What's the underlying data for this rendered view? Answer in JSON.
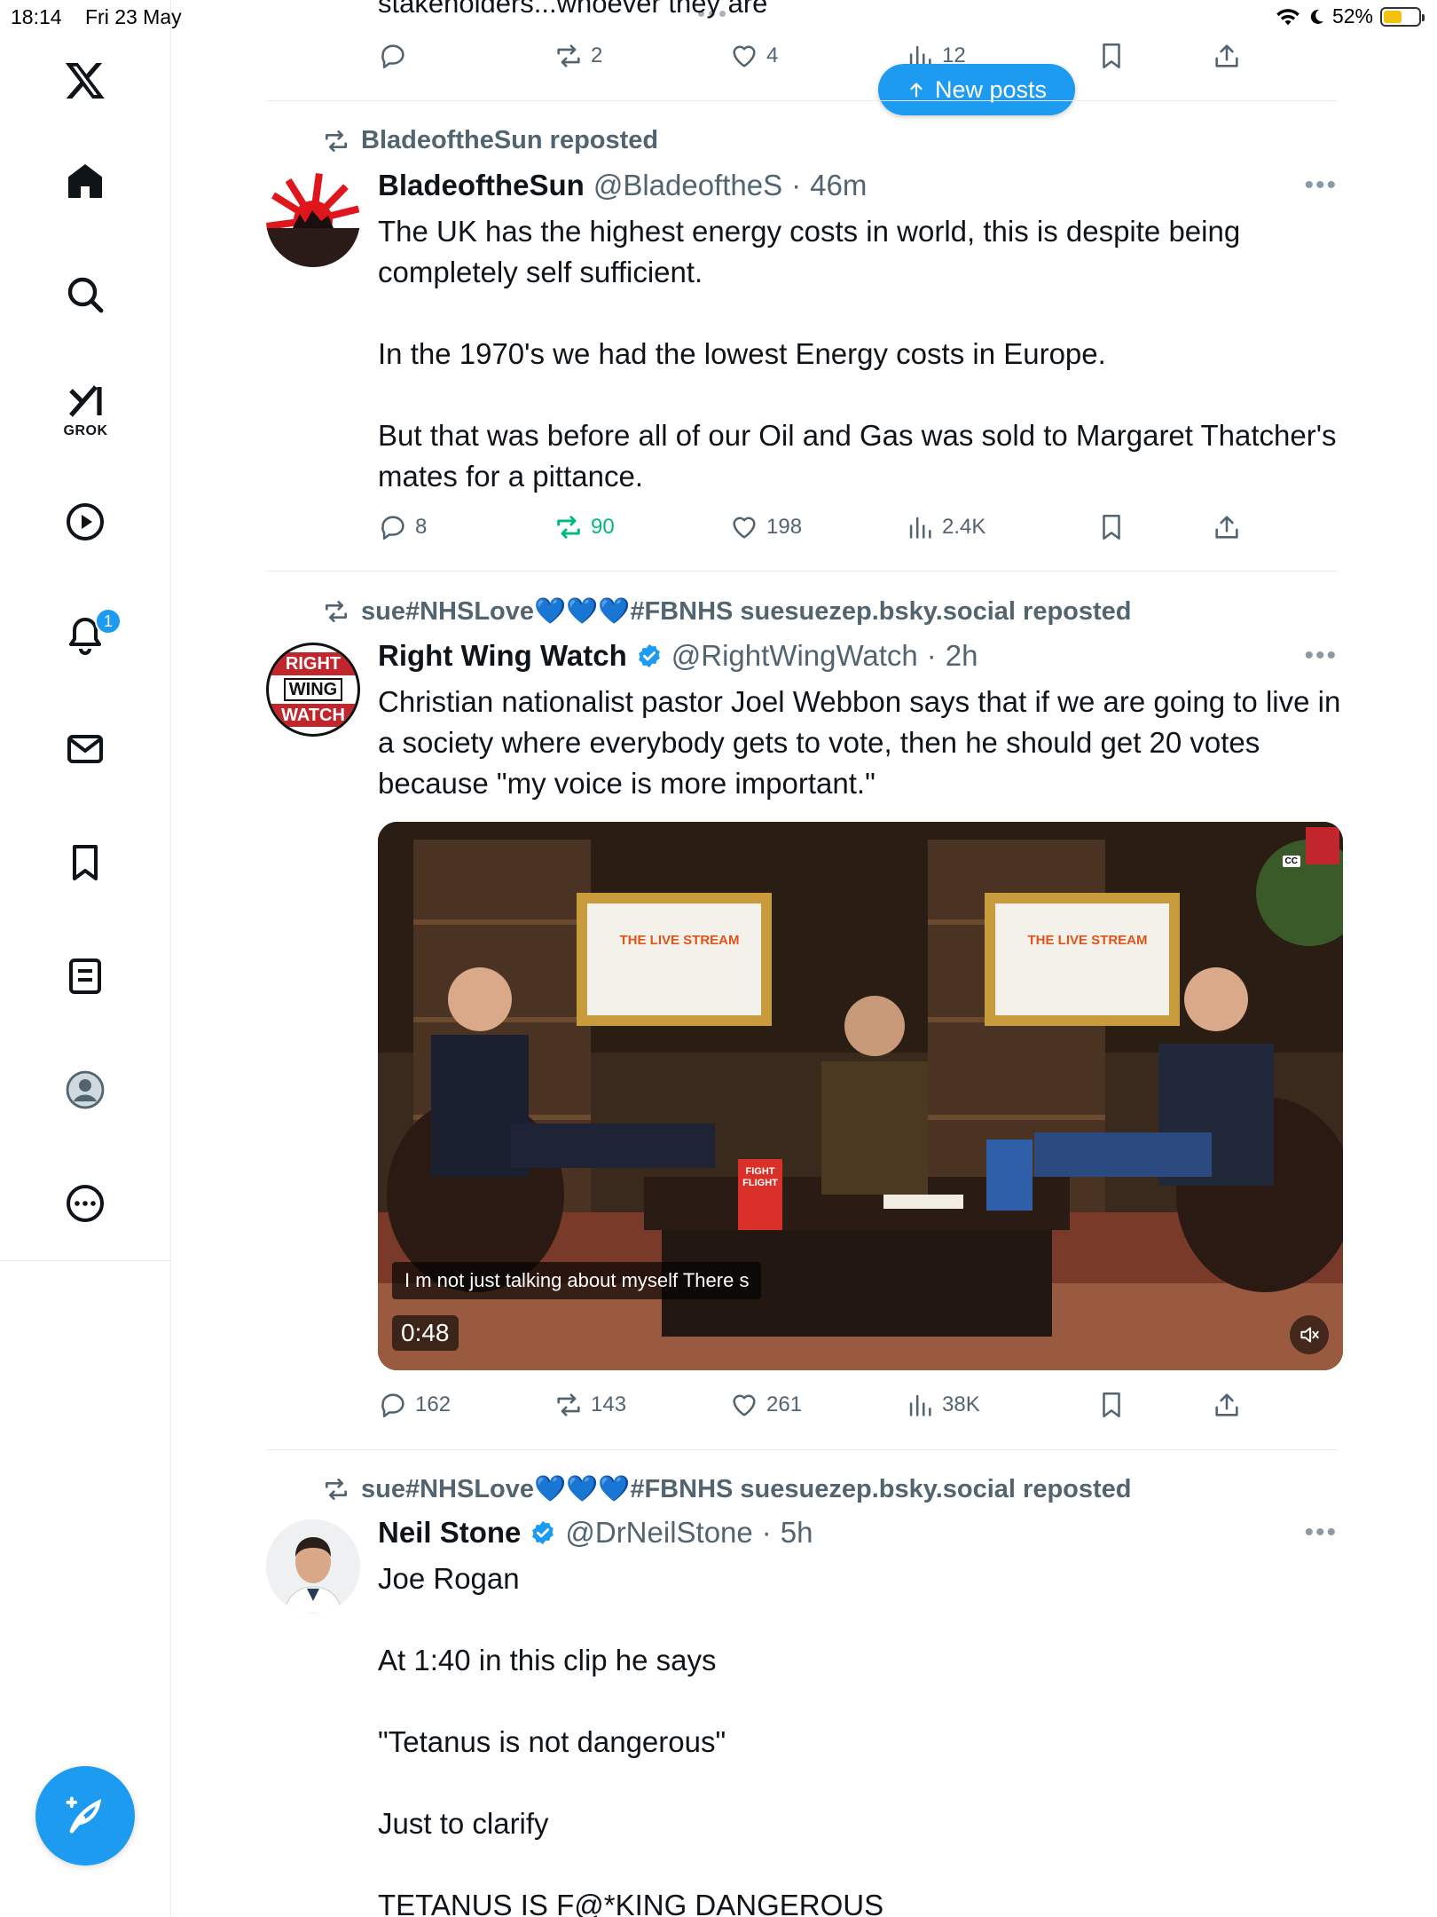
{
  "status_bar": {
    "time": "18:14",
    "date": "Fri 23 May",
    "battery": "52%",
    "battery_level": 0.52
  },
  "colors": {
    "accent": "#1d9bf0",
    "repost_active": "#00ba7c",
    "muted_text": "#536471"
  },
  "sidebar": {
    "items": [
      {
        "name": "x-logo",
        "icon": "x-logo-icon"
      },
      {
        "name": "home",
        "icon": "home-icon"
      },
      {
        "name": "explore",
        "icon": "search-icon"
      },
      {
        "name": "grok",
        "icon": "grok-icon",
        "label": "GROK"
      },
      {
        "name": "video",
        "icon": "play-icon"
      },
      {
        "name": "notifications",
        "icon": "bell-icon",
        "badge": "1"
      },
      {
        "name": "messages",
        "icon": "mail-icon"
      },
      {
        "name": "bookmarks",
        "icon": "bookmark-icon"
      },
      {
        "name": "lists",
        "icon": "list-icon"
      },
      {
        "name": "profile",
        "icon": "avatar-icon"
      },
      {
        "name": "more",
        "icon": "more-circle-icon"
      }
    ],
    "compose_icon": "compose-feather-icon"
  },
  "new_posts_pill": {
    "label": "New posts",
    "icon": "arrow-up-icon"
  },
  "tweets": [
    {
      "partial_text": "stakeholders...whoever they are",
      "stats": {
        "replies": "",
        "reposts": "2",
        "likes": "4",
        "views": "12"
      }
    },
    {
      "repost_by": "BladeoftheSun reposted",
      "name": "BladeoftheSun",
      "handle": "@BladeoftheS",
      "time": "46m",
      "verified": false,
      "text": "The UK has the highest energy costs in world, this is despite being completely self sufficient.\n\nIn the 1970's we had the lowest Energy costs in Europe.\n\nBut that was before all of our Oil and Gas was sold to Margaret Thatcher's mates for a pittance.",
      "stats": {
        "replies": "8",
        "reposts": "90",
        "likes": "198",
        "views": "2.4K"
      },
      "reposted_by_me": true
    },
    {
      "repost_by_prefix": "sue#NHSLove",
      "repost_by_hearts": "💙💙💙",
      "repost_by_suffix": "#FBNHS suesuezep.bsky.social reposted",
      "name": "Right Wing Watch",
      "handle": "@RightWingWatch",
      "time": "2h",
      "verified": true,
      "avatar_text": [
        "RIGHT",
        "WING",
        "WATCH"
      ],
      "text": "Christian nationalist pastor Joel Webbon says that if we are going to live in a society where everybody gets to vote, then he should get 20 votes because \"my voice is more important.\"",
      "video": {
        "caption": "I m not just talking about myself There s",
        "duration": "0:48",
        "screen_text_left": "THE LIVE STREAM",
        "screen_text_right": "THE LIVE STREAM",
        "book_text": "FIGHT FLIGHT",
        "cc_label": "CC"
      },
      "stats": {
        "replies": "162",
        "reposts": "143",
        "likes": "261",
        "views": "38K"
      }
    },
    {
      "repost_by_prefix": "sue#NHSLove",
      "repost_by_hearts": "💙💙💙",
      "repost_by_suffix": "#FBNHS suesuezep.bsky.social reposted",
      "name": "Neil Stone",
      "handle": "@DrNeilStone",
      "time": "5h",
      "verified": true,
      "text": "Joe Rogan\n\nAt 1:40 in this clip he says\n\n\"Tetanus is not dangerous\"\n\nJust to clarify\n\nTETANUS IS F@*KING DANGEROUS"
    }
  ]
}
